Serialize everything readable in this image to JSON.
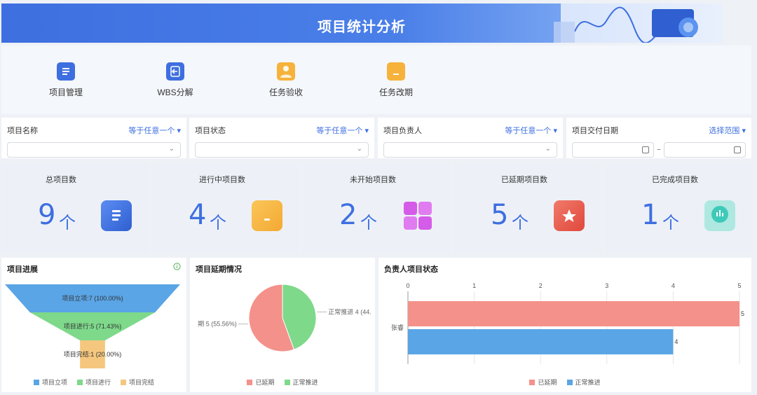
{
  "header": {
    "title": "项目统计分析"
  },
  "quick_links": [
    {
      "label": "项目管理",
      "icon": "document-icon",
      "color": "#3e6fe0"
    },
    {
      "label": "WBS分解",
      "icon": "import-icon",
      "color": "#3e6fe0"
    },
    {
      "label": "任务验收",
      "icon": "user-check-icon",
      "color": "#f6b23a"
    },
    {
      "label": "任务改期",
      "icon": "calendar-change-icon",
      "color": "#f6b23a"
    }
  ],
  "filters": [
    {
      "label": "项目名称",
      "op": "等于任意一个"
    },
    {
      "label": "项目状态",
      "op": "等于任意一个"
    },
    {
      "label": "项目负责人",
      "op": "等于任意一个"
    },
    {
      "label": "项目交付日期",
      "op": "选择范围",
      "range_sep": "~"
    }
  ],
  "stats": [
    {
      "title": "总项目数",
      "value": "9",
      "unit": "个",
      "icon": "list-doc-icon"
    },
    {
      "title": "进行中项目数",
      "value": "4",
      "unit": "个",
      "icon": "folder-icon"
    },
    {
      "title": "未开始项目数",
      "value": "2",
      "unit": "个",
      "icon": "grid-icon"
    },
    {
      "title": "已延期项目数",
      "value": "5",
      "unit": "个",
      "icon": "star-flag-icon"
    },
    {
      "title": "已完成项目数",
      "value": "1",
      "unit": "个",
      "icon": "chart-circle-icon"
    }
  ],
  "panels": {
    "progress": {
      "title": "项目进展",
      "info_icon": "info-icon"
    },
    "delay": {
      "title": "项目延期情况"
    },
    "owner": {
      "title": "负责人项目状态"
    }
  },
  "chart_data": [
    {
      "type": "funnel",
      "categories": [
        "项目立项",
        "项目进行",
        "项目完结"
      ],
      "values": [
        7,
        5,
        1
      ],
      "percents": [
        100.0,
        71.43,
        20.0
      ],
      "data_labels": [
        "项目立项:7 (100.00%)",
        "项目进行:5 (71.43%)",
        "项目完结:1 (20.00%)"
      ],
      "colors": [
        "#5aa5e6",
        "#7ed98b",
        "#f5c77e"
      ],
      "legend": [
        "项目立项",
        "项目进行",
        "项目完结"
      ]
    },
    {
      "type": "pie",
      "categories": [
        "已延期",
        "正常推进"
      ],
      "values": [
        5,
        4
      ],
      "percents": [
        55.56,
        44.44
      ],
      "data_labels": [
        "期 5 (55.56%)",
        "正常推进 4 (44."
      ],
      "colors": [
        "#f4918a",
        "#7ed98b"
      ],
      "legend": [
        "已延期",
        "正常推进"
      ]
    },
    {
      "type": "bar",
      "orientation": "horizontal",
      "categories": [
        "张睿"
      ],
      "series": [
        {
          "name": "已延期",
          "values": [
            5
          ],
          "color": "#f4918a"
        },
        {
          "name": "正常推进",
          "values": [
            4
          ],
          "color": "#5aa5e6"
        }
      ],
      "xticks": [
        "0",
        "1",
        "2",
        "3",
        "4",
        "5"
      ],
      "xlim": [
        0,
        5
      ],
      "legend": [
        "已延期",
        "正常推进"
      ]
    }
  ]
}
